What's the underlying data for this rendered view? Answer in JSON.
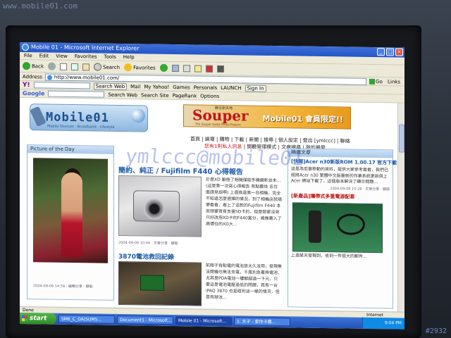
{
  "photo_overlay": {
    "url_watermark": "www.mobile01.com",
    "image_number": "#2932"
  },
  "window": {
    "title": "Mobile 01 - Microsoft Internet Explorer"
  },
  "menu": [
    "File",
    "Edit",
    "View",
    "Favorites",
    "Tools",
    "Help"
  ],
  "toolbar": {
    "back": "Back",
    "search": "Search",
    "favorites": "Favorites"
  },
  "address": {
    "label": "Address",
    "value": "http://www.mobile01.com/",
    "go": "Go",
    "links": "Links"
  },
  "yahoo_bar": {
    "logo": "Y!",
    "search_web": "Search Web",
    "mail": "Mail",
    "my_yahoo": "My Yahoo!",
    "games": "Games",
    "personals": "Personals",
    "launch": "LAUNCH",
    "sign_in": "Sign In"
  },
  "google_bar": {
    "logo": "Google",
    "search_web": "Search Web",
    "search_site": "Search Site",
    "pagerank": "PageRank",
    "options": "Options"
  },
  "site": {
    "logo": "Mobile01",
    "logo_tagline": "Mobile Devices · Broadband · Lifestyle",
    "banner": {
      "brand": "Souper",
      "small": "數位新天地",
      "tagline": "The Souper Audio Visual Players",
      "text": "Mobile01 會員限定!!"
    },
    "nav1": "首頁 | 論壇 | 購物 | 下載 | 新聞 | 搜尋 | 個人設定 | 登出 [ymlccc] | 聯絡",
    "nav2_red": "您有1則私人訊息",
    "nav2": " | 閱聽管理模式 | 文章搜尋 | 我的最愛",
    "watermark": "ymlccc@mobile01"
  },
  "potd": {
    "header": "Picture of the Day",
    "caption": "",
    "meta": "2004-09-09 14:59 · 編輯分享 · 靜態"
  },
  "article1": {
    "title": "簡約、純正 / Fujifilm F440 心得報告",
    "body": "於是XD 厭倦了相機僅能手機攝影並未... (這是第一次寫心得報告 有點膽怯 名位面請見諒啊) 上週換過第一台相機，完全不知道怎麼選擇的情況，到了相機店就隨便看看，看上了這款的Fujifilm F440 本來想要買有支援SD卡的，但是那家沒貨只好改用XD卡的F440當分，被推薦入了高價位的XD大...",
    "meta": "2004-09-09 10:44 · 文章分享 · 靜態"
  },
  "article2": {
    "title": "3870電池救回記錄",
    "body": "前陣子有點電的電池放太久沒用，發現無法開機也無法充電，千萬別急著換電池，尤其是PDA電池一樓都超過一千元，只要這是電池電壓過低的問題，我有一台iPAQ 3870 也是碰到這一樣的情況，但是有辦法..."
  },
  "rightcol": {
    "header": "精選文章",
    "news1_title": "[快報]Acer n30新版ROM 1.00.17 官方下載",
    "news1_body": "這是為宏碁移動的資料，提供大家參考看看，我們已經將Acer n30 繁體中文版最新的作業系統更新與上Acer 網站下載了，這個版本解決了顯示問題...",
    "news1_meta": "2004-09-09 15:28 · 文章分享 · 靜態",
    "news2_title": "[新產品]攜帶式多重電源配套",
    "news2_body": "上週某天發現到，收到一件很大的郵件..."
  },
  "statusbar": {
    "left": "Done",
    "zone": "Internet"
  },
  "taskbar": {
    "start": "start",
    "tasks": [
      "SMK_C_OA(SUMS...",
      "Document1 - Microsoft...",
      "Mobile 01 - Microsoft...",
      "1. 天子 - 愛你卡農..."
    ],
    "clock": "9:04 PM"
  }
}
